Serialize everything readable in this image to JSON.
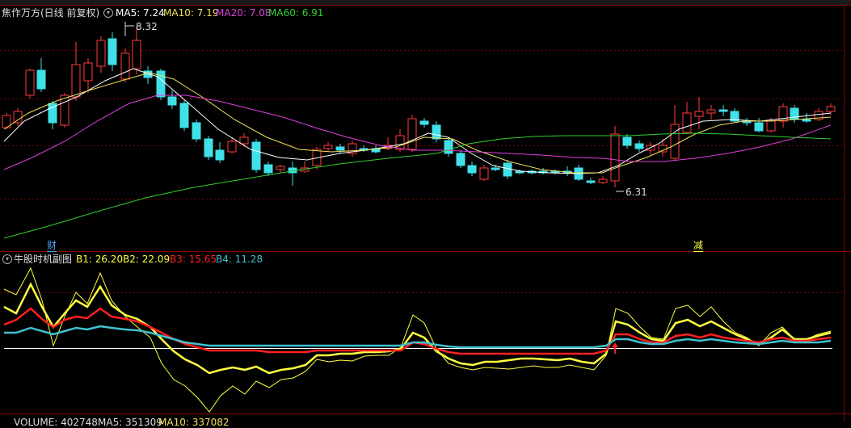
{
  "main_chart": {
    "title": "焦作万方(日线 前复权)",
    "ma5": "MA5: 7.24",
    "ma10": "MA10: 7.19",
    "ma20": "MA20: 7.08",
    "ma60": "MA60: 6.91",
    "high_label": "8.32",
    "low_label": "6.31",
    "marker_cai": "财",
    "marker_jian": "减"
  },
  "sub_chart": {
    "title": "牛股时机副图",
    "b1": "B1: 26.20",
    "b2": "B2: 22.09",
    "b3": "B3: 15.65",
    "b4": "B4: 11.28"
  },
  "volume_bar": {
    "volume": "VOLUME: 402748",
    "ma5": "MA5: 351309",
    "ma10": "MA10: 337082"
  },
  "colors": {
    "up": "#ff3b3b",
    "down": "#3fe0e8",
    "ma5": "#ffffff",
    "ma10": "#f2e15a",
    "ma20": "#e040e0",
    "ma60": "#2ed12e",
    "b1": "#ffff40",
    "b2": "#ffff40",
    "b3": "#ff2020",
    "b4": "#40c0d0"
  }
}
